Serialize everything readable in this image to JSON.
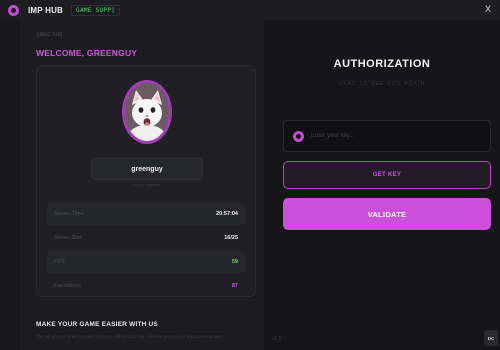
{
  "window": {
    "app_title": "IMP HUB",
    "game_tag": "GAME SUPP|",
    "close_label": "X"
  },
  "profile": {
    "breadcrumb": "gatoz hub",
    "welcome": "WELCOME, GREENGUY",
    "username": "greenguy",
    "username_sub": "Roblox username"
  },
  "stats": [
    {
      "label": "Server Time",
      "value": "20:57:04",
      "color": "#f0f0f3"
    },
    {
      "label": "Server Size",
      "value": "16/25",
      "color": "#f0f0f3"
    },
    {
      "label": "FPS",
      "value": "59",
      "color": "#5fd86b"
    },
    {
      "label": "Executions",
      "value": "87",
      "color": "#cf55df"
    }
  ],
  "promo": {
    "title": "MAKE YOUR GAME EASIER WITH US",
    "subtitle": "Get full access to all premium features with a valid key. Join our Discord for support & updates"
  },
  "auth": {
    "title": "AUTHORIZATION",
    "subtitle": "GLAD TO SEE YOU AGAIN",
    "key_placeholder": "Enter your key...",
    "key_icon": "key-ring-icon",
    "get_key_label": "GET KEY",
    "validate_label": "VALIDATE",
    "version": "v1.0",
    "discord_label": "DC"
  },
  "colors": {
    "accent": "#cc4fdc",
    "background": "#17171b",
    "fps_green": "#5fd86b"
  }
}
